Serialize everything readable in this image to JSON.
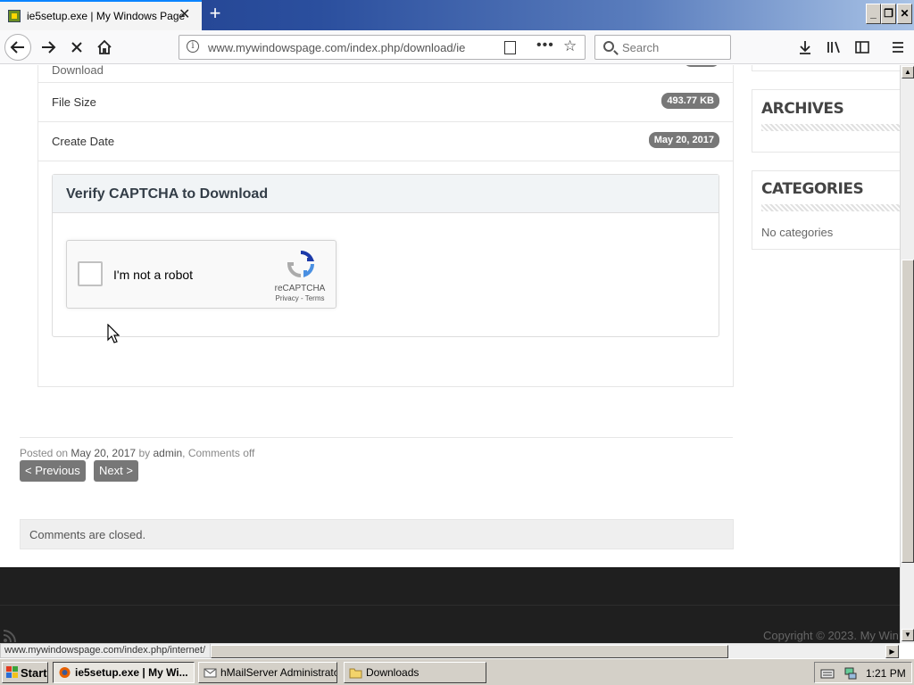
{
  "browser": {
    "tab_title": "ie5setup.exe | My Windows Page",
    "tab_close": "✕",
    "new_tab": "+",
    "window_buttons": {
      "minimize": "_",
      "maximize": "❐",
      "close": "✕"
    },
    "url": "www.mywindowspage.com/index.php/download/ie",
    "search_placeholder": "Search",
    "status_url": "www.mywindowspage.com/index.php/internet/"
  },
  "download_meta": {
    "rows": [
      {
        "label": "Download",
        "value": ""
      },
      {
        "label": "File Size",
        "value": "493.77 KB"
      },
      {
        "label": "Create Date",
        "value": "May 20, 2017"
      }
    ]
  },
  "captcha": {
    "title": "Verify CAPTCHA to Download",
    "checkbox_label": "I'm not a robot",
    "brand": "reCAPTCHA",
    "terms": "Privacy - Terms"
  },
  "post": {
    "posted_prefix": "Posted on",
    "date": "May 20, 2017",
    "by": "by",
    "author": "admin",
    "comments_status": ", Comments off",
    "previous_label": "< Previous",
    "next_label": "Next >",
    "comments_closed": "Comments are closed."
  },
  "sidebar": {
    "archives_title": "ARCHIVES",
    "categories_title": "CATEGORIES",
    "categories_empty": "No categories"
  },
  "footer": {
    "copyright": "Copyright © 2023. My Win"
  },
  "taskbar": {
    "start_label": "Start",
    "tasks": [
      {
        "label": "ie5setup.exe | My Wi...",
        "active": true
      },
      {
        "label": "hMailServer Administrato...",
        "active": false
      },
      {
        "label": "Downloads",
        "active": false
      }
    ],
    "clock": "1:21 PM"
  },
  "colors": {
    "badge": "#777777",
    "pager_button": "#777777",
    "footer_bg": "#1f1f1f",
    "panel_header": "#f1f4f6"
  }
}
